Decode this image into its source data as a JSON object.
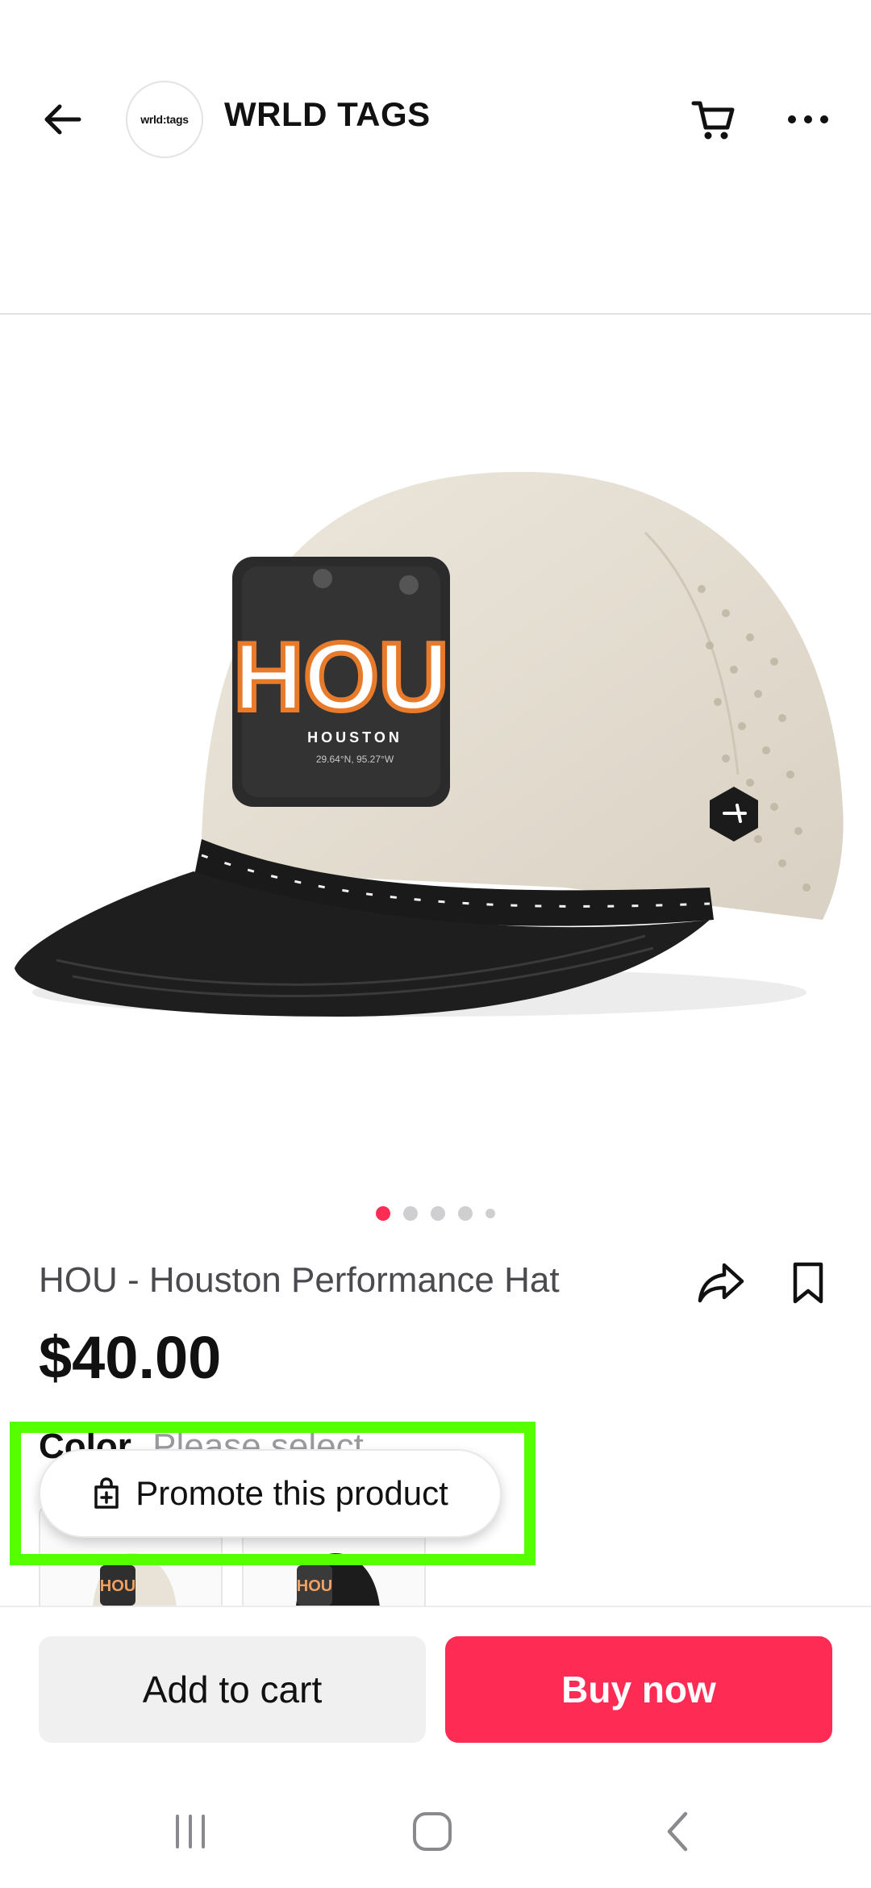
{
  "header": {
    "shop_logo_text": "wrld:tags",
    "shop_name": "WRLD TAGS",
    "icons": {
      "back": "arrow-left-icon",
      "cart": "cart-icon",
      "more": "more-horizontal-icon"
    }
  },
  "product": {
    "image_patch_code": "HOU",
    "image_patch_city": "HOUSTON",
    "image_patch_coords": "29.64°N, 95.27°W",
    "gallery": {
      "count": 5,
      "active_index": 0
    },
    "title": "HOU - Houston Performance Hat",
    "price": "$40.00",
    "color_label": "Color",
    "color_value": "Please select",
    "swatches": [
      {
        "code": "HOU",
        "crown": "#e9e3d7",
        "brim": "#1f1f1f"
      },
      {
        "code": "HOU",
        "crown": "#1c1c1c",
        "brim": "#1c1c1c"
      }
    ],
    "icons": {
      "share": "share-icon",
      "save": "bookmark-icon"
    }
  },
  "promote": {
    "label": "Promote this product",
    "icon": "shopping-bag-plus-icon",
    "highlight_color": "#55ff00"
  },
  "actions": {
    "add_to_cart": "Add to cart",
    "buy_now": "Buy now",
    "buy_color": "#fe2c55"
  },
  "system_nav": {
    "recent": "recent-apps-icon",
    "home": "home-icon",
    "back": "back-chevron-icon"
  }
}
